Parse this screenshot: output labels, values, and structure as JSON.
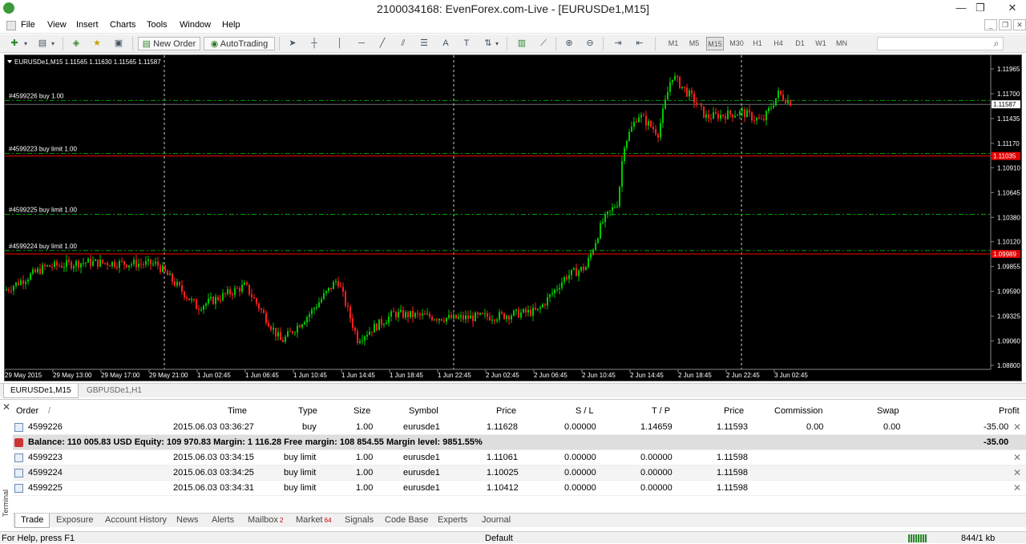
{
  "window": {
    "title": "2100034168: EvenForex.com-Live - [EURUSDe1,M15]",
    "minimize": "—",
    "restore": "❐",
    "close": "✕"
  },
  "menu": [
    "File",
    "View",
    "Insert",
    "Charts",
    "Tools",
    "Window",
    "Help"
  ],
  "toolbar": {
    "new_order": "New Order",
    "autotrading": "AutoTrading",
    "timeframes": [
      "M1",
      "M5",
      "M15",
      "M30",
      "H1",
      "H4",
      "D1",
      "W1",
      "MN"
    ]
  },
  "chart": {
    "header": "EURUSDe1,M15  1.11565 1.11630 1.11565 1.11587",
    "orders": [
      {
        "label": "#4599226 buy 1.00",
        "price": 1.11628
      },
      {
        "label": "#4599223 buy limit 1.00",
        "price": 1.11061
      },
      {
        "label": "#4599225 buy limit 1.00",
        "price": 1.10412
      },
      {
        "label": "#4599224 buy limit 1.00",
        "price": 1.10025
      }
    ],
    "price_ticks": [
      "1.11965",
      "1.11700",
      "1.11435",
      "1.11170",
      "1.10910",
      "1.10645",
      "1.10380",
      "1.10120",
      "1.09855",
      "1.09590",
      "1.09325",
      "1.09060",
      "1.08800"
    ],
    "current_price": "1.11587",
    "red_line_labels": [
      "1.11035",
      "1.09989"
    ],
    "time_ticks": [
      "29 May 2015",
      "29 May 13:00",
      "29 May 17:00",
      "29 May 21:00",
      "1 Jun 02:45",
      "1 Jun 06:45",
      "1 Jun 10:45",
      "1 Jun 14:45",
      "1 Jun 18:45",
      "1 Jun 22:45",
      "2 Jun 02:45",
      "2 Jun 06:45",
      "2 Jun 10:45",
      "2 Jun 14:45",
      "2 Jun 18:45",
      "2 Jun 22:45",
      "3 Jun 02:45"
    ],
    "colors": {
      "bull": "#00c800",
      "bear": "#ff2020",
      "background": "#000000",
      "order_line": "#00a000",
      "limit_line": "#ff0000"
    }
  },
  "chart_tabs": [
    "EURUSDe1,M15",
    "GBPUSDe1,H1"
  ],
  "terminal": {
    "headers": [
      "Order",
      "/",
      "Time",
      "Type",
      "Size",
      "Symbol",
      "Price",
      "S / L",
      "T / P",
      "Price",
      "Commission",
      "Swap",
      "Profit"
    ],
    "open_row": {
      "order": "4599226",
      "time": "2015.06.03 03:36:27",
      "type": "buy",
      "size": "1.00",
      "symbol": "eurusde1",
      "price": "1.11628",
      "sl": "0.00000",
      "tp": "1.14659",
      "cur": "1.11593",
      "commission": "0.00",
      "swap": "0.00",
      "profit": "-35.00"
    },
    "balance_text": "Balance: 110 005.83 USD  Equity: 109 970.83  Margin: 1 116.28  Free margin: 108 854.55  Margin level: 9851.55%",
    "balance_profit": "-35.00",
    "pending": [
      {
        "order": "4599223",
        "time": "2015.06.03 03:34:15",
        "type": "buy limit",
        "size": "1.00",
        "symbol": "eurusde1",
        "price": "1.11061",
        "sl": "0.00000",
        "tp": "0.00000",
        "cur": "1.11598"
      },
      {
        "order": "4599224",
        "time": "2015.06.03 03:34:25",
        "type": "buy limit",
        "size": "1.00",
        "symbol": "eurusde1",
        "price": "1.10025",
        "sl": "0.00000",
        "tp": "0.00000",
        "cur": "1.11598"
      },
      {
        "order": "4599225",
        "time": "2015.06.03 03:34:31",
        "type": "buy limit",
        "size": "1.00",
        "symbol": "eurusde1",
        "price": "1.10412",
        "sl": "0.00000",
        "tp": "0.00000",
        "cur": "1.11598"
      }
    ],
    "side_label": "Terminal",
    "tabs": [
      {
        "label": "Trade"
      },
      {
        "label": "Exposure"
      },
      {
        "label": "Account History"
      },
      {
        "label": "News"
      },
      {
        "label": "Alerts"
      },
      {
        "label": "Mailbox",
        "badge": "2"
      },
      {
        "label": "Market",
        "badge": "64"
      },
      {
        "label": "Signals"
      },
      {
        "label": "Code Base"
      },
      {
        "label": "Experts"
      },
      {
        "label": "Journal"
      }
    ]
  },
  "status": {
    "help": "For Help, press F1",
    "profile": "Default",
    "traffic": "844/1 kb"
  }
}
